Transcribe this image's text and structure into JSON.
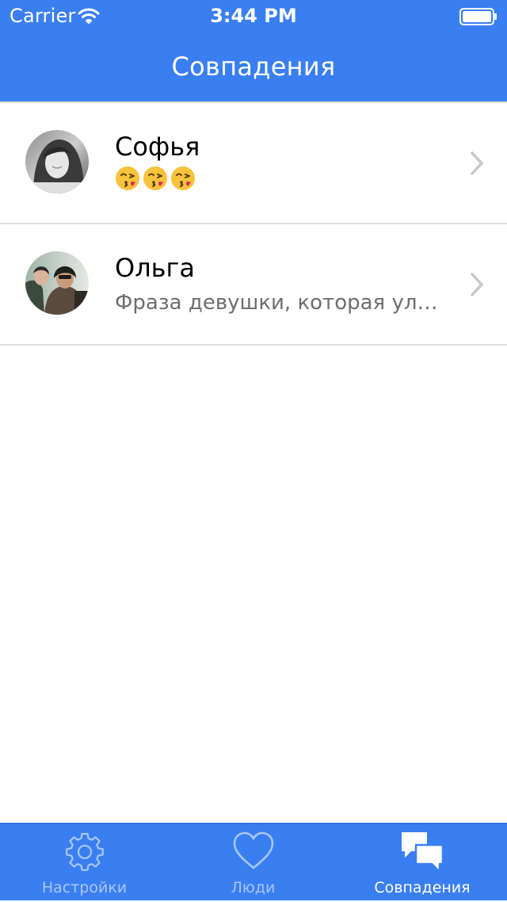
{
  "status_bar": {
    "carrier": "Carrier",
    "time": "3:44 PM"
  },
  "nav": {
    "title": "Совпадения"
  },
  "matches": [
    {
      "name": "Софья",
      "message_type": "emoji",
      "emoji": [
        "face-throwing-kiss-icon",
        "face-throwing-kiss-icon",
        "face-throwing-kiss-icon"
      ]
    },
    {
      "name": "Ольга",
      "message_type": "text",
      "message": "Фраза девушки, которая уло..."
    }
  ],
  "tabbar": {
    "tabs": [
      {
        "label": "Настройки",
        "icon": "gear-icon",
        "active": false
      },
      {
        "label": "Люди",
        "icon": "heart-icon",
        "active": false
      },
      {
        "label": "Совпадения",
        "icon": "chat-bubbles-icon",
        "active": true
      }
    ]
  },
  "colors": {
    "brand_blue": "#3a7ff2",
    "separator": "#dcdcdc",
    "inactive_tab": "#a9c6f6",
    "chevron": "#c7c7cc"
  }
}
